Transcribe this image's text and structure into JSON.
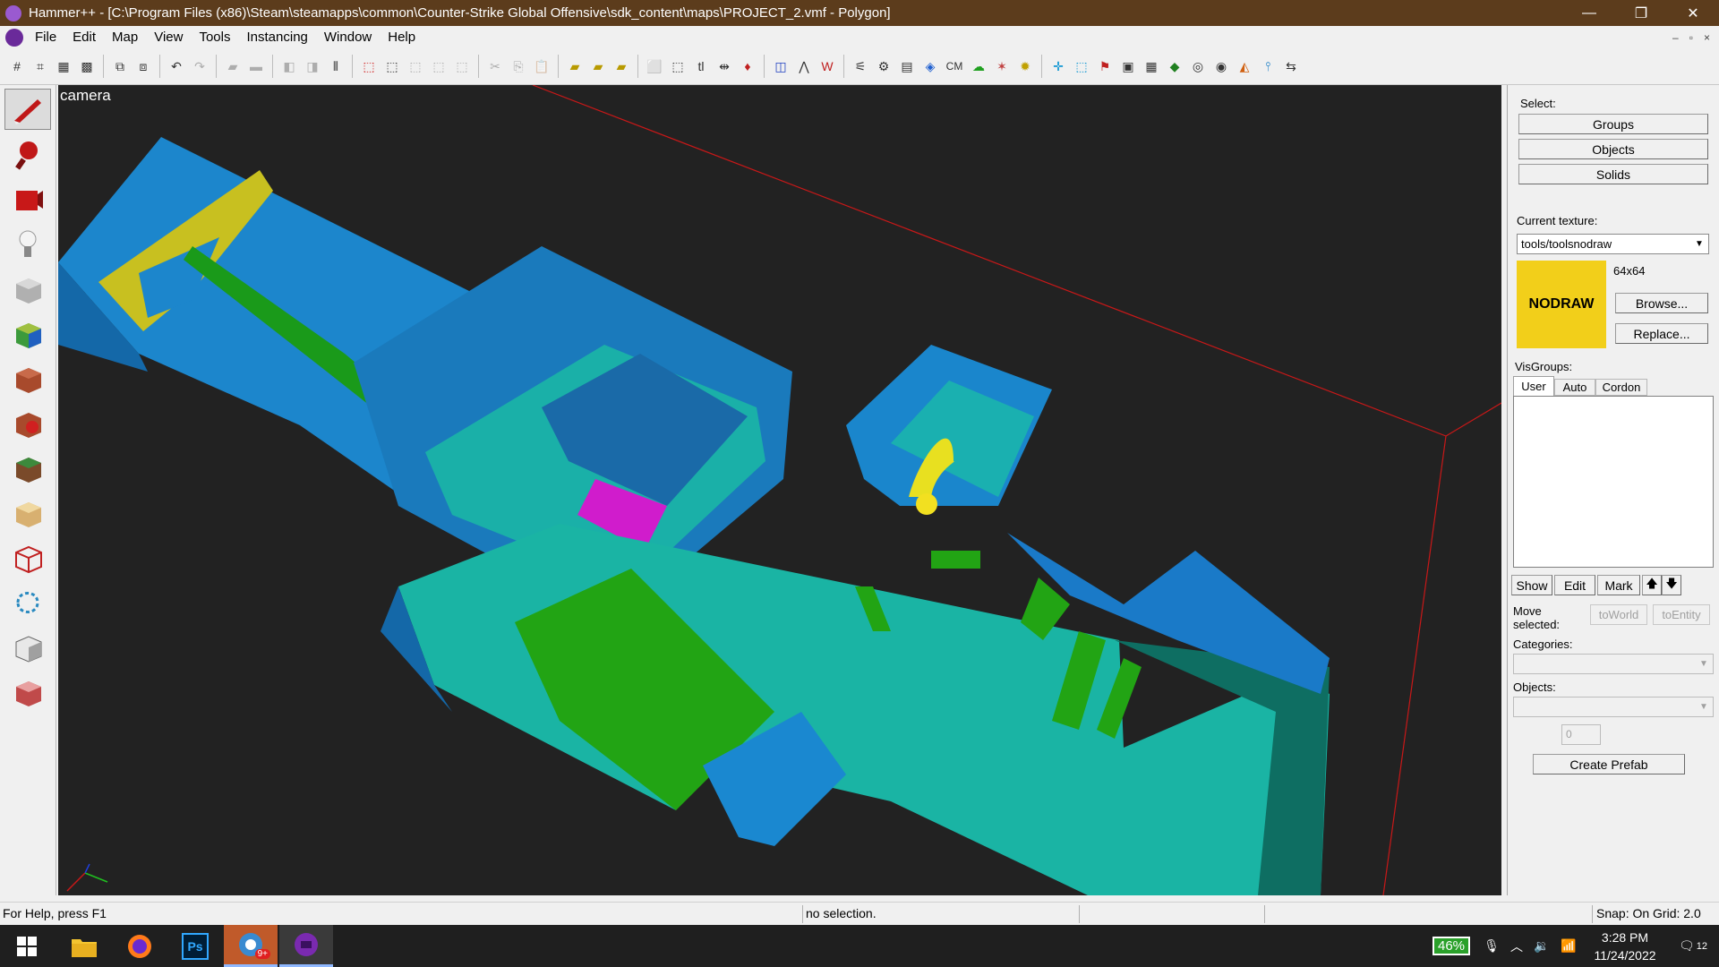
{
  "window": {
    "title": "Hammer++ - [C:\\Program Files (x86)\\Steam\\steamapps\\common\\Counter-Strike Global Offensive\\sdk_content\\maps\\PROJECT_2.vmf - Polygon]",
    "minimize": "—",
    "maximize": "❐",
    "close": "✕"
  },
  "menu": {
    "items": [
      "File",
      "Edit",
      "Map",
      "View",
      "Tools",
      "Instancing",
      "Window",
      "Help"
    ],
    "mdi_min": "–",
    "mdi_restore": "▫",
    "mdi_close": "×"
  },
  "toolbar": {
    "cm_label": "CM"
  },
  "viewport": {
    "label": "camera"
  },
  "right_panel": {
    "select_label": "Select:",
    "groups": "Groups",
    "objects": "Objects",
    "solids": "Solids",
    "current_texture_label": "Current texture:",
    "current_texture": "tools/toolsnodraw",
    "texture_size": "64x64",
    "texture_preview_text": "NODRAW",
    "browse": "Browse...",
    "replace": "Replace...",
    "visgroups_label": "VisGroups:",
    "tabs": [
      "User",
      "Auto",
      "Cordon"
    ],
    "show": "Show",
    "edit": "Edit",
    "mark": "Mark",
    "up": "🡅",
    "down": "🡇",
    "move_selected": "Move selected:",
    "to_world": "toWorld",
    "to_entity": "toEntity",
    "categories_label": "Categories:",
    "objects_label": "Objects:",
    "spinner_value": "0",
    "create_prefab": "Create Prefab"
  },
  "status": {
    "help": "For Help, press F1",
    "selection": "no selection.",
    "snap": "Snap: On Grid: 2.0"
  },
  "taskbar": {
    "battery": "46%",
    "time": "3:28 PM",
    "date": "11/24/2022",
    "notifications": "12",
    "chrome_badge": "9+",
    "ps_label": "Ps"
  },
  "colors": {
    "titlebar": "#5c3c1c",
    "viewport_bg": "#222222",
    "nodraw_yellow": "#f2cf1a",
    "brush_blue": "#1a7ac8",
    "brush_teal": "#1ab0a0",
    "brush_green": "#1fa010",
    "brush_magenta": "#d020c8"
  }
}
